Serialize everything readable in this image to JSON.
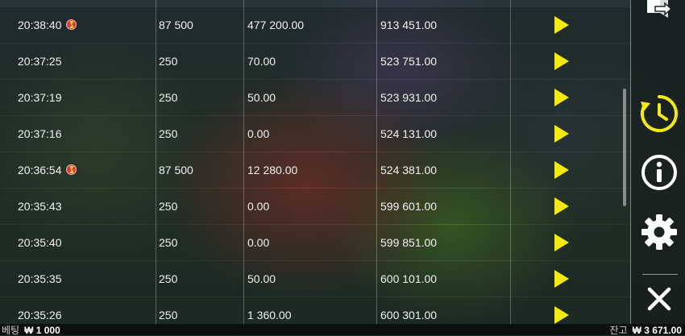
{
  "history": {
    "rows": [
      {
        "time": "20:38:40",
        "bonus": true,
        "bet": "87 500",
        "win": "477 200.00",
        "balance": "913 451.00"
      },
      {
        "time": "20:37:25",
        "bonus": false,
        "bet": "250",
        "win": "70.00",
        "balance": "523 751.00"
      },
      {
        "time": "20:37:19",
        "bonus": false,
        "bet": "250",
        "win": "50.00",
        "balance": "523 931.00"
      },
      {
        "time": "20:37:16",
        "bonus": false,
        "bet": "250",
        "win": "0.00",
        "balance": "524 131.00"
      },
      {
        "time": "20:36:54",
        "bonus": true,
        "bet": "87 500",
        "win": "12 280.00",
        "balance": "524 381.00"
      },
      {
        "time": "20:35:43",
        "bonus": false,
        "bet": "250",
        "win": "0.00",
        "balance": "599 601.00"
      },
      {
        "time": "20:35:40",
        "bonus": false,
        "bet": "250",
        "win": "0.00",
        "balance": "599 851.00"
      },
      {
        "time": "20:35:35",
        "bonus": false,
        "bet": "250",
        "win": "50.00",
        "balance": "600 101.00"
      },
      {
        "time": "20:35:26",
        "bonus": false,
        "bet": "250",
        "win": "1 360.00",
        "balance": "600 301.00"
      }
    ]
  },
  "sidebar": {
    "buttons": [
      {
        "icon": "exit-icon",
        "color": "#ffffff"
      },
      {
        "icon": "history-icon",
        "color": "#f2ea12"
      },
      {
        "icon": "info-icon",
        "color": "#ffffff"
      },
      {
        "icon": "gear-icon",
        "color": "#ffffff"
      },
      {
        "icon": "close-icon",
        "color": "#ffffff"
      }
    ]
  },
  "footer": {
    "bet_label": "베팅",
    "bet_value": "₩ 1 000",
    "balance_label": "잔고",
    "balance_value": "₩ 3 671.00"
  },
  "colors": {
    "accent": "#f2ea12",
    "bonus": "#d9403a"
  }
}
